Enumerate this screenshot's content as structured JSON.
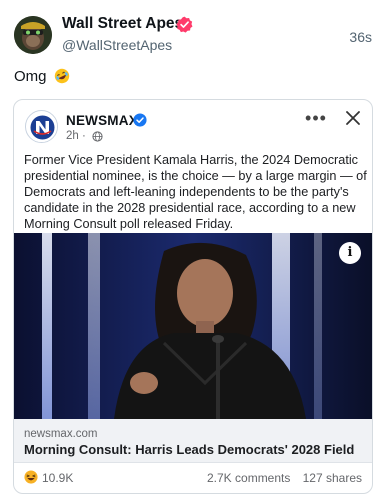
{
  "post": {
    "author_name": "Wall Street Apes",
    "author_handle": "@WallStreetApes",
    "time": "36s",
    "text": "Omg",
    "text_emoji": "rolling-on-floor-laughing-emoji",
    "verified_color": "#ff3b6b"
  },
  "embed": {
    "source_name": "NEWSMAX",
    "source_time": "2h ·",
    "verified_color": "#1877f2",
    "more_label": "•••",
    "body": "Former Vice President Kamala Harris, the 2024 Democratic presidential nominee, is the choice — by a large margin — of Democrats and left-leaning independents to be the party's candidate in the 2028 presidential race, according to a new Morning Consult poll released Friday.",
    "info_label": "i",
    "link": {
      "domain": "newsmax.com",
      "title": "Morning Consult: Harris Leads Democrats' 2028 Field"
    },
    "stats": {
      "reaction_icon": "laughing-emoji",
      "reactions": "10.9K",
      "comments": "2.7K comments",
      "shares": "127 shares"
    }
  }
}
